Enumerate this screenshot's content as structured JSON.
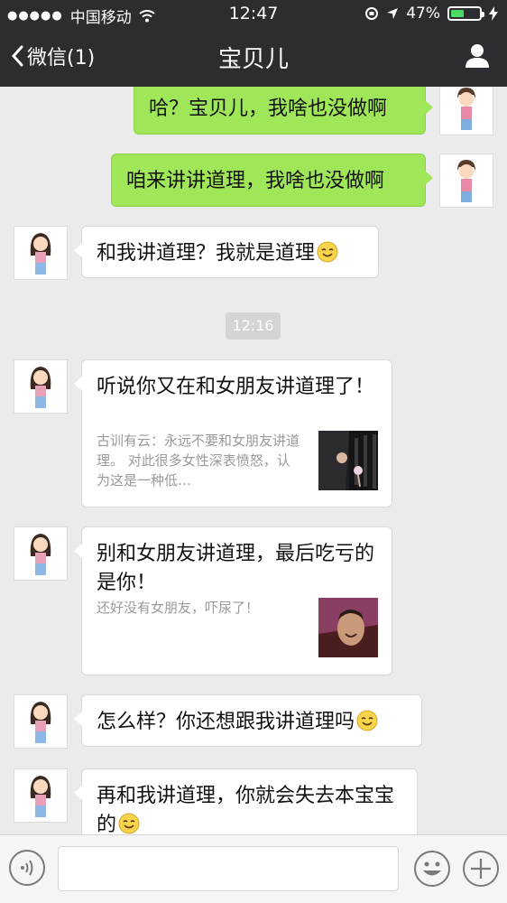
{
  "status": {
    "carrier": "中国移动",
    "time": "12:47",
    "battery_pct": "47%",
    "battery_level": 0.47
  },
  "nav": {
    "back_label": "微信(1)",
    "title": "宝贝儿"
  },
  "messages": [
    {
      "from": "me",
      "text": "哈？宝贝儿，我啥也没做啊"
    },
    {
      "from": "me",
      "text": "咱来讲讲道理，我啥也没做啊"
    },
    {
      "from": "them",
      "text": "和我讲道理？我就是道理",
      "emoji": true
    },
    {
      "timestamp": "12:16"
    },
    {
      "from": "them",
      "type": "card",
      "title": "听说你又在和女朋友讲道理了！",
      "desc": "古训有云：永远不要和女朋友讲道理。 对此很多女性深表愤怒，认为这是一种低…"
    },
    {
      "from": "them",
      "type": "card",
      "title": "别和女朋友讲道理，最后吃亏的是你！",
      "desc": "还好没有女朋友，吓尿了！"
    },
    {
      "from": "them",
      "text": "怎么样？你还想跟我讲道理吗",
      "emoji": true
    },
    {
      "from": "them",
      "text": "再和我讲道理，你就会失去本宝宝的",
      "emoji": true
    }
  ],
  "colors": {
    "topbar": "#2b2d31",
    "my_bubble": "#9fe658",
    "their_bubble": "#ffffff",
    "background": "#ebebeb"
  },
  "icons": [
    "back-chevron-icon",
    "profile-icon",
    "voice-icon",
    "emoji-icon",
    "plus-icon",
    "smile-emoji-icon"
  ]
}
